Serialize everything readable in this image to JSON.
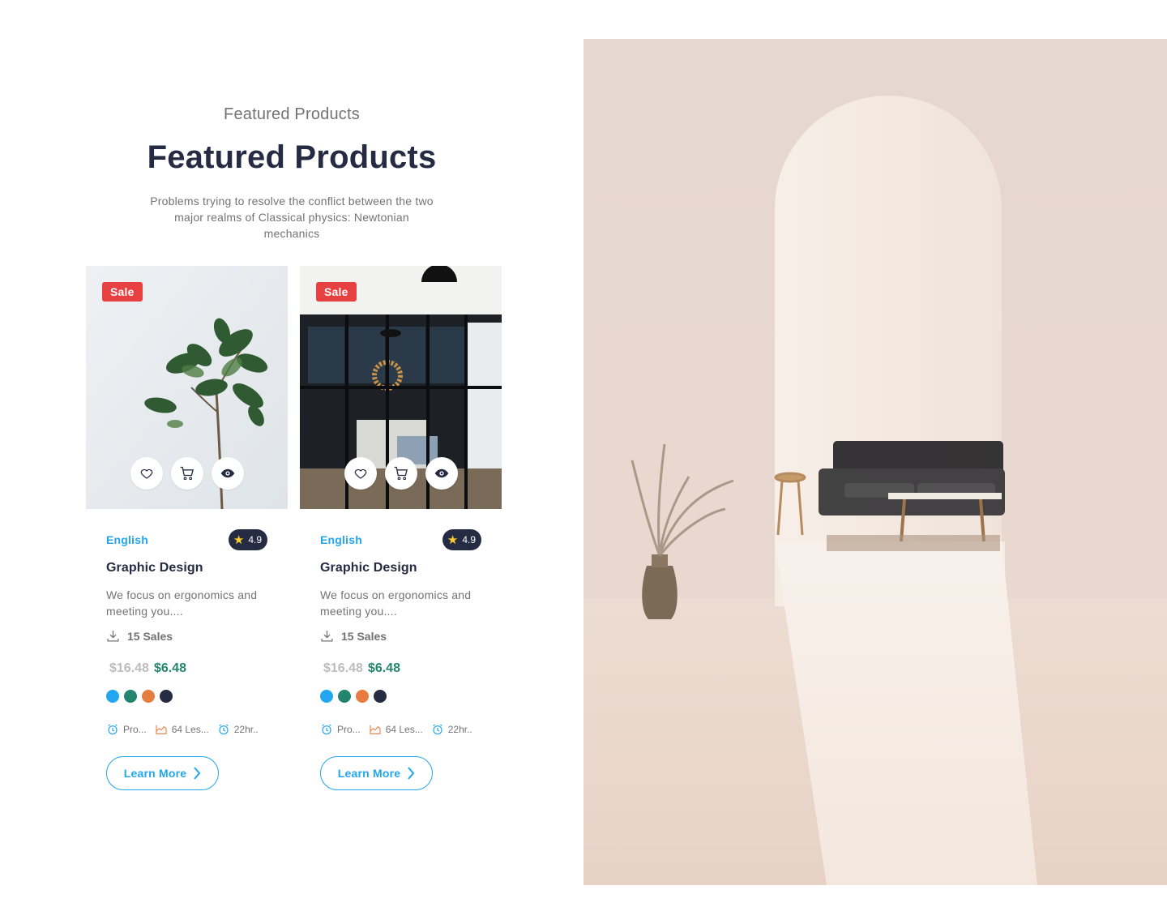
{
  "section": {
    "eyebrow": "Featured Products",
    "title": "Featured Products",
    "description": "Problems trying to resolve the conflict between the two major realms of Classical physics: Newtonian mechanics"
  },
  "products": [
    {
      "badge": "Sale",
      "image": "fiddle-leaf-plant-photo",
      "category": "English",
      "rating": "4.9",
      "title": "Graphic Design",
      "description": "We focus on ergonomics and meeting you....",
      "sales": "15 Sales",
      "price_old": "$16.48",
      "price_new": "$6.48",
      "colors": [
        "#23a6f0",
        "#23856d",
        "#e77c40",
        "#252b42"
      ],
      "meta": [
        "Pro...",
        "64 Les...",
        "22hr.."
      ],
      "cta": "Learn More"
    },
    {
      "badge": "Sale",
      "image": "black-glass-door-interior-photo",
      "category": "English",
      "rating": "4.9",
      "title": "Graphic Design",
      "description": "We focus on ergonomics and meeting you....",
      "sales": "15 Sales",
      "price_old": "$16.48",
      "price_new": "$6.48",
      "colors": [
        "#23a6f0",
        "#23856d",
        "#e77c40",
        "#252b42"
      ],
      "meta": [
        "Pro...",
        "64 Les...",
        "22hr.."
      ],
      "cta": "Learn More"
    }
  ],
  "icons": {
    "wishlist": "heart-icon",
    "cart": "cart-icon",
    "preview": "eye-icon",
    "rating": "star-icon",
    "sales": "download-icon",
    "meta": [
      "alarm-clock-icon",
      "chart-area-icon",
      "alarm-clock-icon"
    ],
    "cta": "chevron-right-icon"
  },
  "hero_image": "minimal-interior-archway-sofa-photo"
}
